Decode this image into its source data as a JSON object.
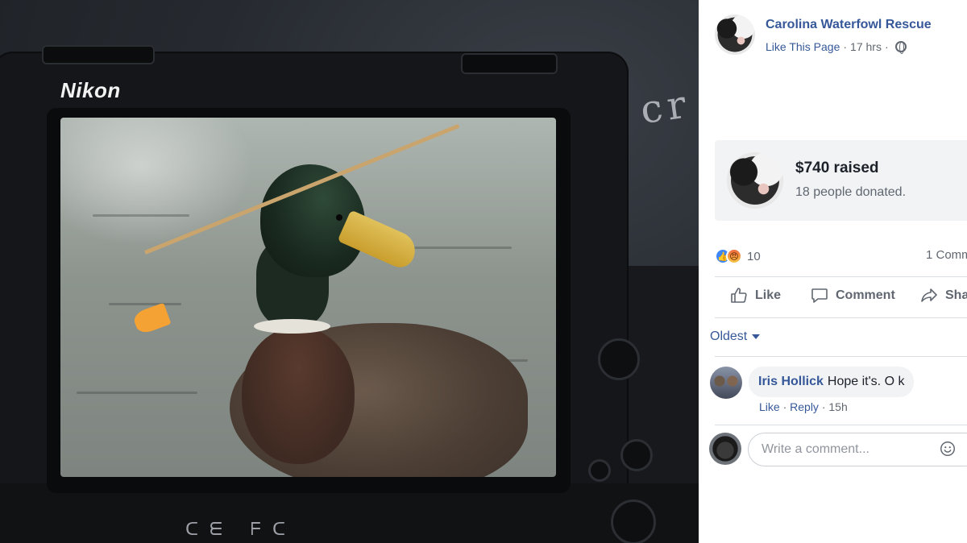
{
  "photo": {
    "camera_brand": "Nikon",
    "body_markings": "ᑕᗴ  ᖴᑕ"
  },
  "post": {
    "page_name": "Carolina Waterfowl Rescue",
    "like_page_label": "Like This Page",
    "separator": "·",
    "time": "17 hrs",
    "privacy_icon": "globe-icon"
  },
  "fundraiser": {
    "amount_label": "$740 raised",
    "donors_label": "18 people donated."
  },
  "reactions": {
    "icons": [
      "like-reaction-icon",
      "angry-reaction-icon"
    ],
    "count": "10",
    "comments_label": "1 Comm"
  },
  "actions": {
    "like": "Like",
    "comment": "Comment",
    "share": "Sha"
  },
  "comments": {
    "sort_label": "Oldest",
    "items": [
      {
        "author": "Iris Hollick",
        "text": "Hope it's. O k",
        "like": "Like",
        "reply": "Reply",
        "separator": "·",
        "time": "15h"
      }
    ],
    "input_placeholder": "Write a comment..."
  },
  "colors": {
    "link_blue": "#365899",
    "meta_gray": "#616770",
    "bubble_bg": "#f2f3f5",
    "like_blue": "#3f86f7"
  }
}
